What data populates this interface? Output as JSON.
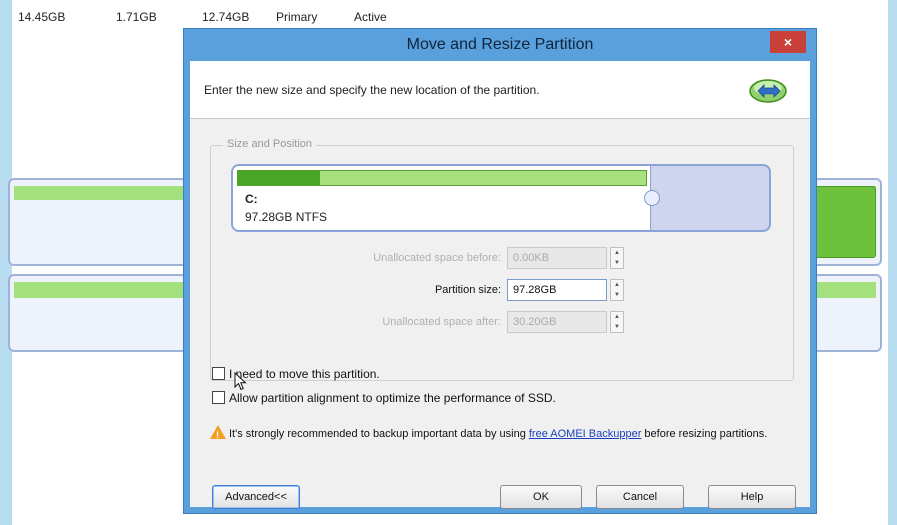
{
  "background": {
    "table_row": [
      "14.45GB",
      "1.71GB",
      "12.74GB",
      "Primary",
      "Active"
    ]
  },
  "dialog": {
    "title": "Move and Resize Partition",
    "close_glyph": "×",
    "instruction": "Enter the new size and specify the new location of the partition.",
    "header_icon": "move-resize-icon",
    "group_label": "Size and Position",
    "partition": {
      "drive": "C:",
      "info": "97.28GB NTFS",
      "used_fraction": 0.2
    },
    "fields": {
      "before_label": "Unallocated space before:",
      "before_value": "0.00KB",
      "size_label": "Partition size:",
      "size_value": "97.28GB",
      "after_label": "Unallocated space after:",
      "after_value": "30.20GB"
    },
    "checks": {
      "move_label": "I need to move this partition.",
      "align_label": "Allow partition alignment to optimize the performance of SSD."
    },
    "warning": {
      "before": "It's strongly recommended to backup important data by using ",
      "link": "free AOMEI Backupper",
      "after": " before resizing partitions."
    },
    "buttons": {
      "advanced": "Advanced<<",
      "ok": "OK",
      "cancel": "Cancel",
      "help": "Help"
    }
  },
  "colors": {
    "title_bar": "#5aa0dd",
    "close": "#c9403a",
    "used_green": "#49a626",
    "free_green": "#a8e07f",
    "warning": "#f0a022"
  }
}
